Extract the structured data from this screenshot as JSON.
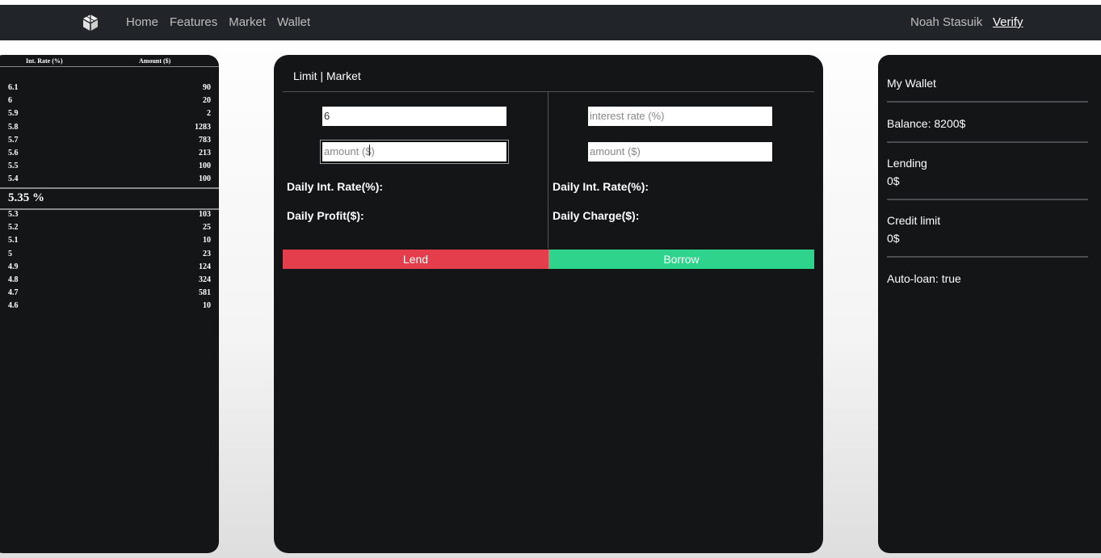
{
  "nav": {
    "links": [
      "Home",
      "Features",
      "Market",
      "Wallet"
    ],
    "user": "Noah Stasuik",
    "verify": "Verify"
  },
  "orderbook": {
    "headers": [
      "Int. Rate (%)",
      "Amount ($)"
    ],
    "asks": [
      {
        "rate": "6.1",
        "amount": "90"
      },
      {
        "rate": "6",
        "amount": "20"
      },
      {
        "rate": "5.9",
        "amount": "2"
      },
      {
        "rate": "5.8",
        "amount": "1283"
      },
      {
        "rate": "5.7",
        "amount": "783"
      },
      {
        "rate": "5.6",
        "amount": "213"
      },
      {
        "rate": "5.5",
        "amount": "100"
      },
      {
        "rate": "5.4",
        "amount": "100"
      }
    ],
    "mid": "5.35 %",
    "bids": [
      {
        "rate": "5.3",
        "amount": "103"
      },
      {
        "rate": "5.2",
        "amount": "25"
      },
      {
        "rate": "5.1",
        "amount": "10"
      },
      {
        "rate": "5",
        "amount": "23"
      },
      {
        "rate": "4.9",
        "amount": "124"
      },
      {
        "rate": "4.8",
        "amount": "324"
      },
      {
        "rate": "4.7",
        "amount": "581"
      },
      {
        "rate": "4.6",
        "amount": "10"
      }
    ]
  },
  "trade": {
    "tabs": {
      "limit": "Limit",
      "sep": " | ",
      "market": "Market"
    },
    "lend": {
      "rate_value": "6",
      "amount_placeholder": "amount ($)",
      "rate_label": "Daily Int. Rate(%):",
      "result_label": "Daily Profit($):",
      "button": "Lend"
    },
    "borrow": {
      "rate_placeholder": "interest rate (%)",
      "amount_placeholder": "amount ($)",
      "rate_label": "Daily Int. Rate(%):",
      "result_label": "Daily Charge($):",
      "button": "Borrow"
    },
    "colors": {
      "lend": "#e43d4b",
      "borrow": "#2ed38c"
    }
  },
  "wallet": {
    "title": "My Wallet",
    "balance": "Balance: 8200$",
    "lending_label": "Lending",
    "lending_value": "0$",
    "credit_label": "Credit limit",
    "credit_value": "0$",
    "autoloan": "Auto-loan: true"
  }
}
